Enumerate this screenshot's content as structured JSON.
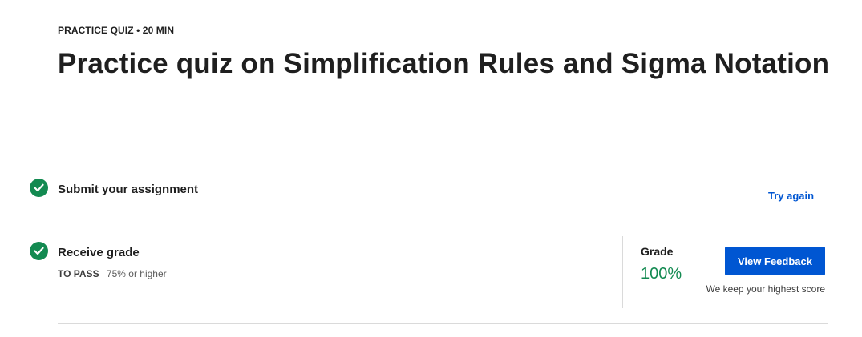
{
  "header": {
    "eyebrow": "PRACTICE QUIZ • 20 MIN",
    "title": "Practice quiz on Simplification Rules and Sigma Notation"
  },
  "steps": [
    {
      "title": "Submit your assignment",
      "status": "complete",
      "action_label": "Try again"
    },
    {
      "title": "Receive grade",
      "status": "complete",
      "to_pass_label": "TO PASS",
      "to_pass_value": "75% or higher"
    }
  ],
  "grade": {
    "label": "Grade",
    "value": "100%",
    "button_label": "View Feedback",
    "note": "We keep your highest score"
  },
  "icons": {
    "step_complete": "check-circle-icon"
  },
  "colors": {
    "success": "#138a51",
    "accent": "#0056d2",
    "text": "#1f1f1f",
    "divider": "#dadada"
  }
}
